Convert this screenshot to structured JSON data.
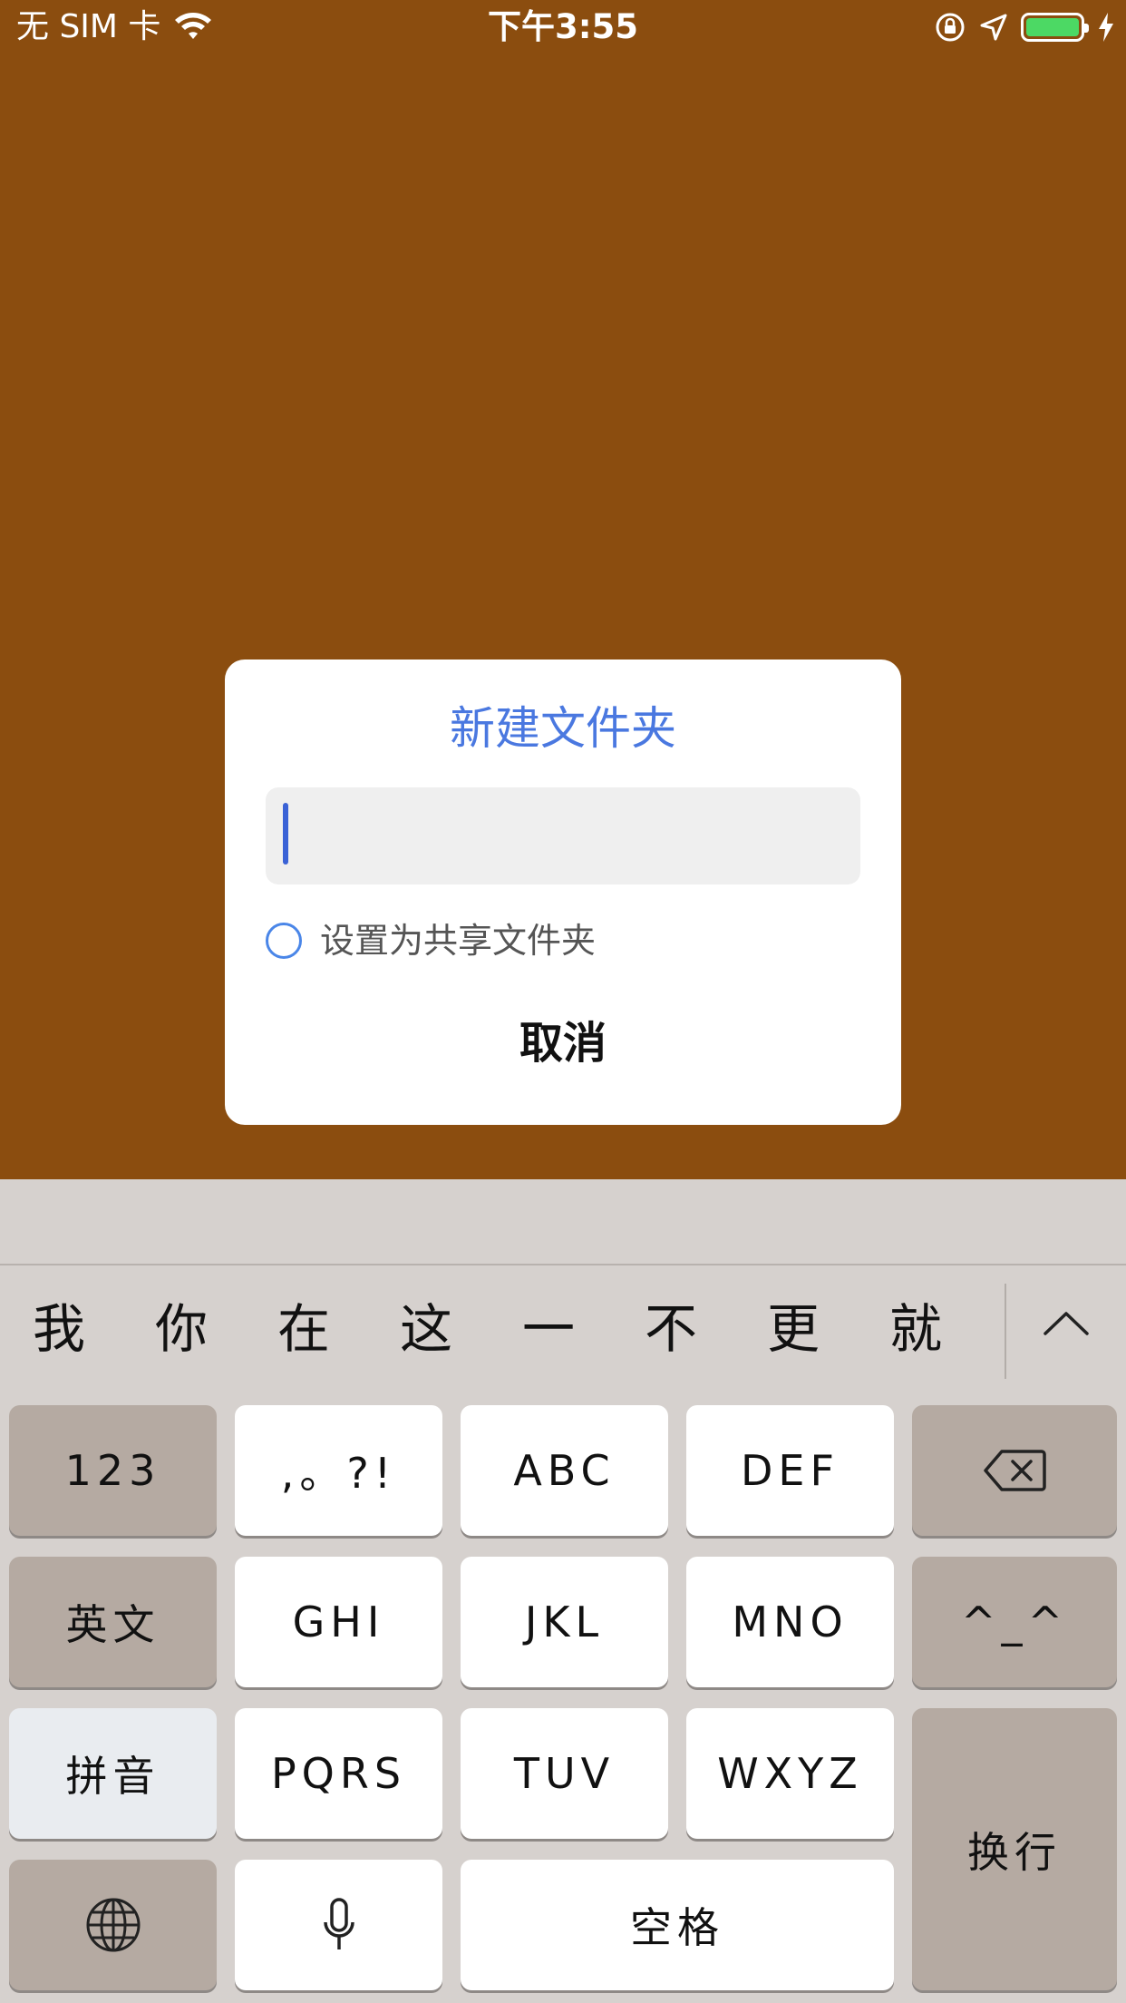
{
  "status_bar": {
    "carrier": "无 SIM 卡",
    "time": "下午3:55",
    "battery_color": "#4CD964"
  },
  "dialog": {
    "title": "新建文件夹",
    "input_value": "",
    "share_label": "设置为共享文件夹",
    "cancel_label": "取消",
    "title_color": "#4A78E0"
  },
  "keyboard": {
    "candidates": [
      "我",
      "你",
      "在",
      "这",
      "一",
      "不",
      "更",
      "就"
    ],
    "keys": {
      "num": "123",
      "punct": ",。?!",
      "abc": "ABC",
      "def": "DEF",
      "english": "英文",
      "ghi": "GHI",
      "jkl": "JKL",
      "mno": "MNO",
      "emoticon": "^_^",
      "pinyin": "拼音",
      "pqrs": "PQRS",
      "tuv": "TUV",
      "wxyz": "WXYZ",
      "return": "换行",
      "space": "空格"
    },
    "icons": {
      "backspace": "backspace-icon",
      "globe": "globe-icon",
      "mic": "microphone-icon",
      "expand": "chevron-up-icon"
    }
  },
  "background_color": "#8B4D0F"
}
